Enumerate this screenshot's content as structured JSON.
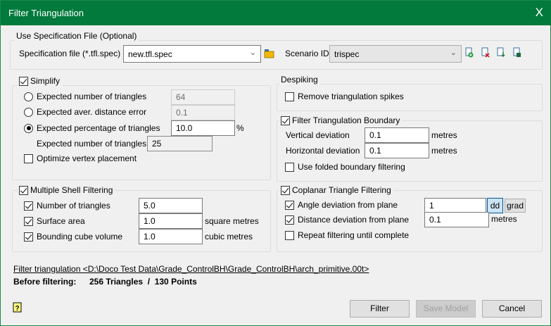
{
  "window": {
    "title": "Filter Triangulation",
    "close": "X"
  },
  "spec": {
    "group_label": "Use Specification File (Optional)",
    "file_label": "Specification file (*.tfl.spec)",
    "file_value": "new.tfl.spec",
    "scenario_label": "Scenario ID",
    "scenario_value": "trispec",
    "icons": [
      "folder-open-icon",
      "add-scenario-icon",
      "delete-scenario-icon",
      "import-scenario-icon",
      "save-scenario-icon"
    ]
  },
  "simplify": {
    "label": "Simplify",
    "checked": true,
    "opt1_label": "Expected number of triangles",
    "opt1_value": "64",
    "opt2_label": "Expected aver. distance error",
    "opt2_value": "0.1",
    "opt3_label": "Expected percentage of triangles",
    "opt3_value": "10.0",
    "opt3_unit": "%",
    "selected": 3,
    "expected_label": "Expected number of triangles",
    "expected_value": "25",
    "optimize_label": "Optimize vertex placement",
    "optimize_checked": false
  },
  "shell": {
    "label": "Multiple Shell Filtering",
    "checked": true,
    "rows": [
      {
        "label": "Number of triangles",
        "value": "5.0",
        "unit": "",
        "checked": true
      },
      {
        "label": "Surface area",
        "value": "1.0",
        "unit": "square metres",
        "checked": true
      },
      {
        "label": "Bounding cube volume",
        "value": "1.0",
        "unit": "cubic metres",
        "checked": true
      }
    ]
  },
  "despiking": {
    "label": "Despiking",
    "remove_label": "Remove triangulation spikes",
    "remove_checked": false
  },
  "boundary": {
    "label": "Filter Triangulation Boundary",
    "checked": true,
    "vertical_label": "Vertical deviation",
    "vertical_value": "0.1",
    "vertical_unit": "metres",
    "horizontal_label": "Horizontal deviation",
    "horizontal_value": "0.1",
    "horizontal_unit": "metres",
    "folded_label": "Use folded boundary filtering",
    "folded_checked": false
  },
  "coplanar": {
    "label": "Coplanar Triangle Filtering",
    "checked": true,
    "angle_label": "Angle deviation from plane",
    "angle_value": "1",
    "angle_checked": true,
    "dd_label": "dd",
    "grad_label": "grad",
    "distance_label": "Distance deviation from plane",
    "distance_value": "0.1",
    "distance_unit": "metres",
    "distance_checked": true,
    "repeat_label": "Repeat filtering until complete",
    "repeat_checked": false
  },
  "footer": {
    "link": "Filter triangulation <D:\\Doco Test Data\\Grade_ControlBH\\Grade_ControlBH\\arch_primitive.00t>",
    "before_label": "Before filtering:",
    "before_value": "256 Triangles  /  130 Points",
    "filter_btn": "Filter",
    "save_btn": "Save Model",
    "cancel_btn": "Cancel"
  },
  "colors": {
    "titlebar": "#017a3c",
    "selected_unit": "#cce4f7"
  }
}
